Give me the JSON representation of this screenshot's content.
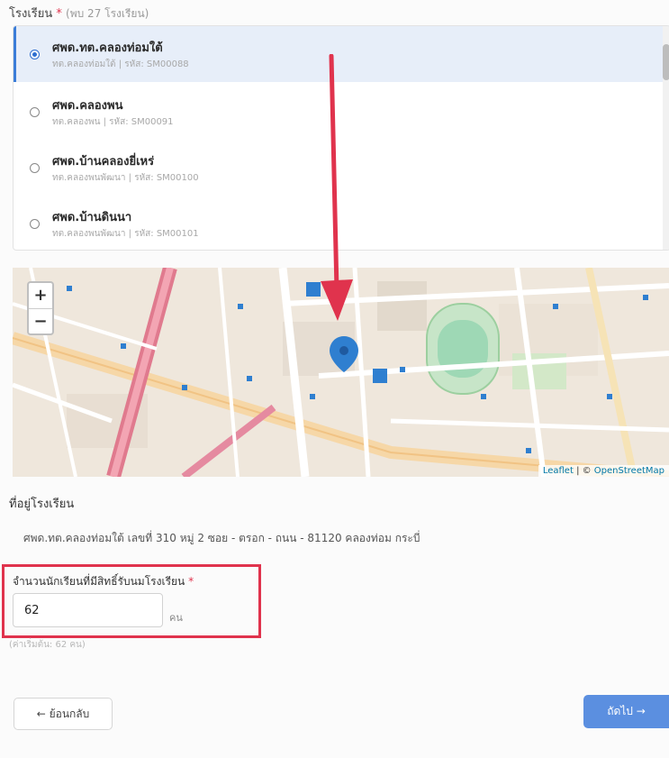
{
  "school_section": {
    "label": "โรงเรียน",
    "required_mark": "*",
    "count_text": "(พบ 27 โรงเรียน)"
  },
  "schools": [
    {
      "name": "ศพด.ทต.คลองท่อมใต้",
      "sub": "ทต.คลองท่อมใต้ | รหัส: SM00088",
      "selected": true
    },
    {
      "name": "ศพด.คลองพน",
      "sub": "ทต.คลองพน | รหัส: SM00091",
      "selected": false
    },
    {
      "name": "ศพด.บ้านคลองยี่เหร่",
      "sub": "ทต.คลองพนพัฒนา | รหัส: SM00100",
      "selected": false
    },
    {
      "name": "ศพด.บ้านดินนา",
      "sub": "ทต.คลองพนพัฒนา | รหัส: SM00101",
      "selected": false
    }
  ],
  "map": {
    "zoom_in": "+",
    "zoom_out": "−",
    "attribution_leaflet": "Leaflet",
    "attribution_sep": " | © ",
    "attribution_osm": "OpenStreetMap",
    "marker_color": "#2f7fd0"
  },
  "address": {
    "label": "ที่อยู่โรงเรียน",
    "text": "ศพด.ทต.คลองท่อมใต้ เลขที่ 310 หมู่ 2 ซอย - ตรอก - ถนน - 81120 คลองท่อม กระบี่"
  },
  "students": {
    "label": "จำนวนนักเรียนที่มีสิทธิ์รับนมโรงเรียน",
    "required_mark": "*",
    "value": "62",
    "unit": "คน",
    "hint": "(ค่าเริ่มต้น: 62 คน)"
  },
  "nav": {
    "back_label": "← ย้อนกลับ",
    "next_label": "ถัดไป →"
  },
  "colors": {
    "accent": "#3b7dd8",
    "required": "#e0334d",
    "annotation": "#e0334d"
  }
}
